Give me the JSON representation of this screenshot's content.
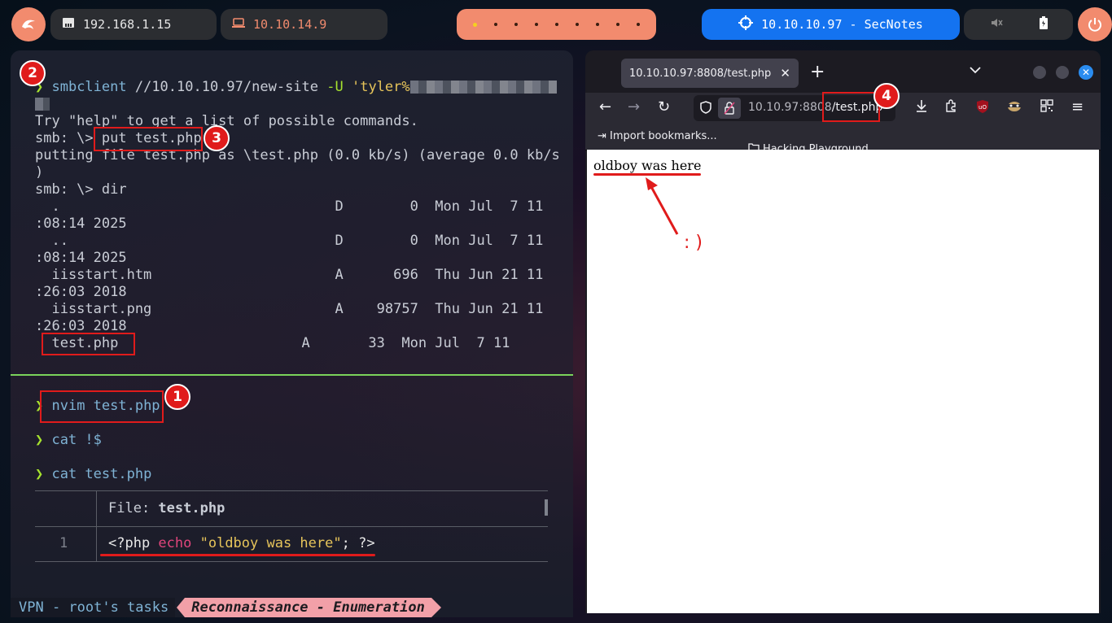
{
  "topbar": {
    "launcher_icon": "kali-dragon-icon",
    "host_ip": "192.168.1.15",
    "vpn_ip": "10.10.14.9",
    "target_label": "10.10.10.97 - SecNotes",
    "power_icon": "power-icon"
  },
  "terminal": {
    "smb_cmd": "smbclient",
    "smb_path": " //10.10.10.97/new-site ",
    "smb_flag": "-U",
    "smb_user": " 'tyler%",
    "help_text": "Try \"help\" to get a list of possible commands.",
    "smb_prompt1": "smb: \\> ",
    "smb_put": "put test.php",
    "putting_line": "putting file test.php as \\test.php (0.0 kb/s) (average 0.0 kb/s",
    "putting_cont": ")",
    "smb_prompt2": "smb: \\> dir",
    "dir": [
      {
        "l1": "  .                                 D        0  Mon Jul  7 11",
        "l2": ":08:14 2025"
      },
      {
        "l1": "  ..                                D        0  Mon Jul  7 11",
        "l2": ":08:14 2025"
      },
      {
        "l1": "  iisstart.htm                      A      696  Thu Jun 21 11",
        "l2": ":26:03 2018"
      },
      {
        "l1": "  iisstart.png                      A    98757  Thu Jun 21 11",
        "l2": ":26:03 2018"
      }
    ],
    "testphp_name": "test.php",
    "testphp_rest": "                      A       33  Mon Jul  7 11",
    "cmd_nvim": "nvim test.php",
    "cmd_cat_last": "cat !$",
    "cmd_cat": "cat test.php",
    "bat_file_label": "File: ",
    "bat_file_name": "test.php",
    "bat_line_num": "1",
    "code_open": "<?php ",
    "code_echo": "echo",
    "code_str": " \"oldboy was here\"",
    "code_close": "; ?>",
    "status_left": "VPN - root's tasks",
    "status_right": "Reconnaissance - Enumeration"
  },
  "annotations": {
    "badge_1": "1",
    "badge_2": "2",
    "badge_3": "3",
    "badge_4": "4",
    "smiley": ": )"
  },
  "browser": {
    "tab_title": "10.10.10.97:8808/test.php",
    "url_prefix": "10.10.97:8808",
    "url_path": "/test.php",
    "bookmark_import": "Import bookmarks...",
    "bookmark_folder": "Hacking Playground",
    "page_text": "oldboy was here"
  }
}
